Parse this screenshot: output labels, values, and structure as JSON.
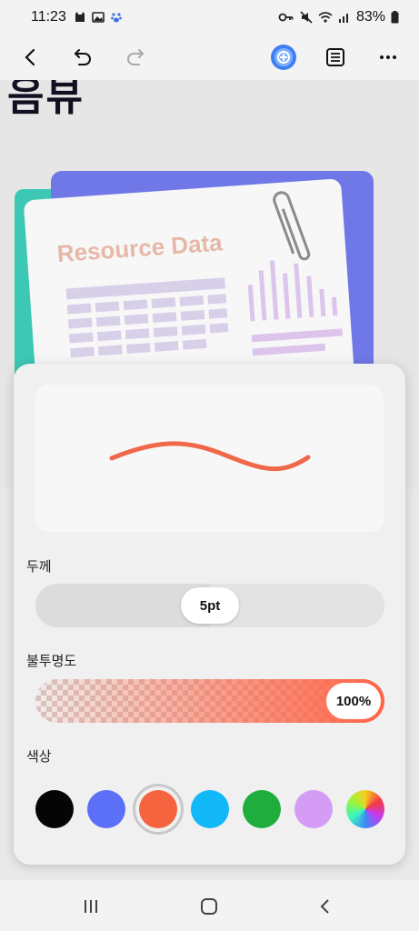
{
  "status_bar": {
    "time": "11:23",
    "battery": "83%",
    "left_icons": [
      "cat-notification-icon",
      "image-notification-icon",
      "paw-notification-icon"
    ],
    "right_icons": [
      "key-icon",
      "mute-icon",
      "wifi-icon",
      "signal-icon",
      "battery-icon"
    ]
  },
  "toolbar": {
    "icons": [
      "back-arrow-icon",
      "undo-icon",
      "redo-icon",
      "ai-assistant-icon",
      "list-view-icon",
      "more-options-icon"
    ]
  },
  "document": {
    "heading": "음뷰",
    "card_title": "Resource Data"
  },
  "pen_panel": {
    "thickness_label": "두께",
    "thickness_value": "5pt",
    "thickness_fraction": 0.5,
    "opacity_label": "불투명도",
    "opacity_value": "100%",
    "opacity_fraction": 1.0,
    "color_label": "색상",
    "stroke_color": "#f0684a",
    "colors": [
      {
        "name": "black",
        "hex": "#050505"
      },
      {
        "name": "blue",
        "hex": "#5b6ff8"
      },
      {
        "name": "orange-red",
        "hex": "#f6633f",
        "selected": true
      },
      {
        "name": "sky-blue",
        "hex": "#12b8f7"
      },
      {
        "name": "green",
        "hex": "#1fae3e"
      },
      {
        "name": "lavender",
        "hex": "#d49cf5"
      },
      {
        "name": "rainbow",
        "hex": "gradient"
      }
    ]
  },
  "nav_bar": {
    "icons": [
      "recent-apps-icon",
      "home-icon",
      "back-icon"
    ]
  }
}
